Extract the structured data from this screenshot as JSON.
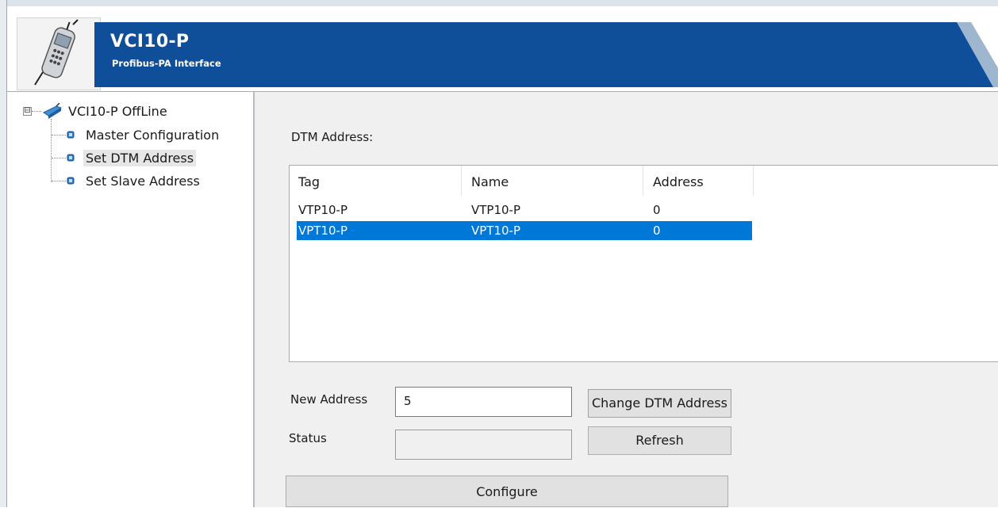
{
  "header": {
    "title": "VCI10-P",
    "subtitle": "Profibus-PA Interface",
    "logo_icon": "device-handheld-icon",
    "banner_color": "#0f4f9a"
  },
  "tree": {
    "root_label": "VCI10-P OffLine",
    "expander": "⊟",
    "items": [
      {
        "label": "Master Configuration"
      },
      {
        "label": "Set DTM Address"
      },
      {
        "label": "Set Slave Address"
      }
    ]
  },
  "panel": {
    "dtm_address_label": "DTM Address:",
    "columns": [
      "Tag",
      "Name",
      "Address"
    ],
    "rows": [
      {
        "tag": "VTP10-P",
        "name": "VTP10-P",
        "address": "0"
      },
      {
        "tag": "VPT10-P",
        "name": "VPT10-P",
        "address": "0"
      }
    ],
    "new_address_label": "New Address",
    "new_address_value": "5",
    "status_label": "Status",
    "status_value": "",
    "change_button": "Change DTM Address",
    "refresh_button": "Refresh",
    "configure_button": "Configure",
    "selection_color": "#0078d7"
  }
}
